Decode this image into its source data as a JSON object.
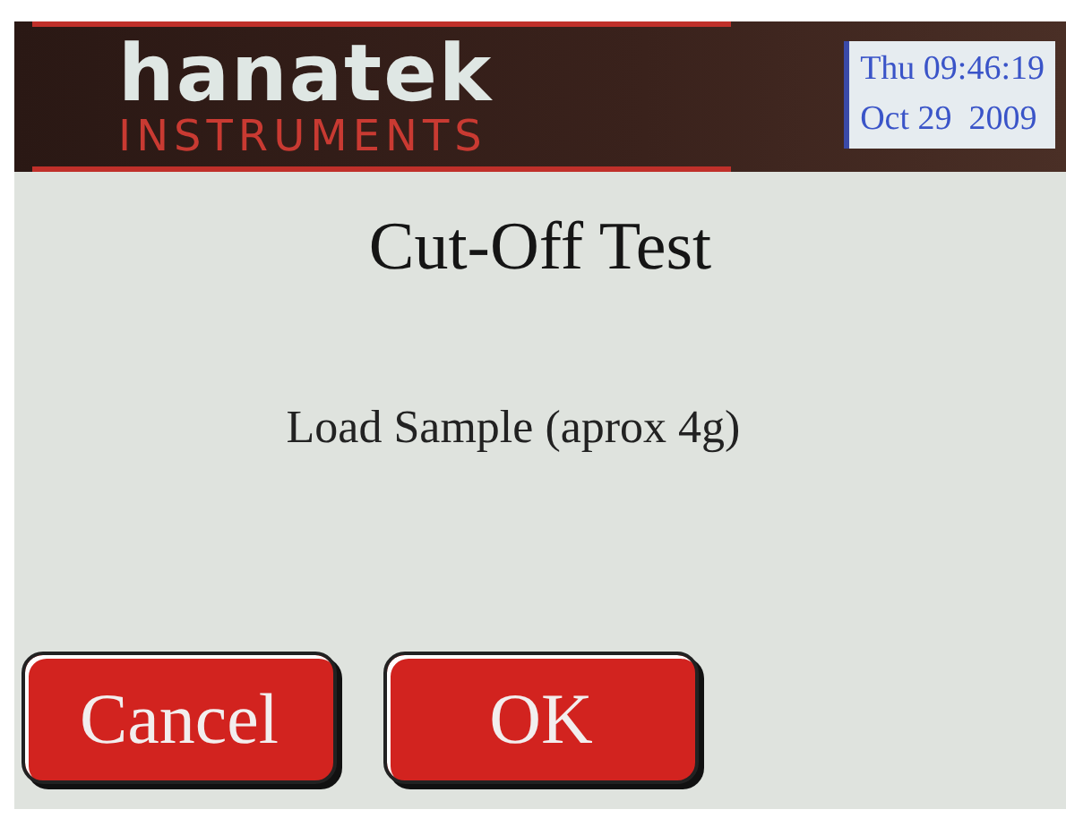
{
  "header": {
    "logo": {
      "name": "hanatek",
      "subtitle": "INSTRUMENTS"
    },
    "datetime": {
      "line_1": "Thu 09:46:19",
      "line_2": "Oct 29  2009"
    }
  },
  "title": "Cut-Off Test",
  "message": "Load Sample (aprox 4g)",
  "buttons": [
    {
      "label": "Cancel"
    },
    {
      "label": "OK"
    }
  ]
}
